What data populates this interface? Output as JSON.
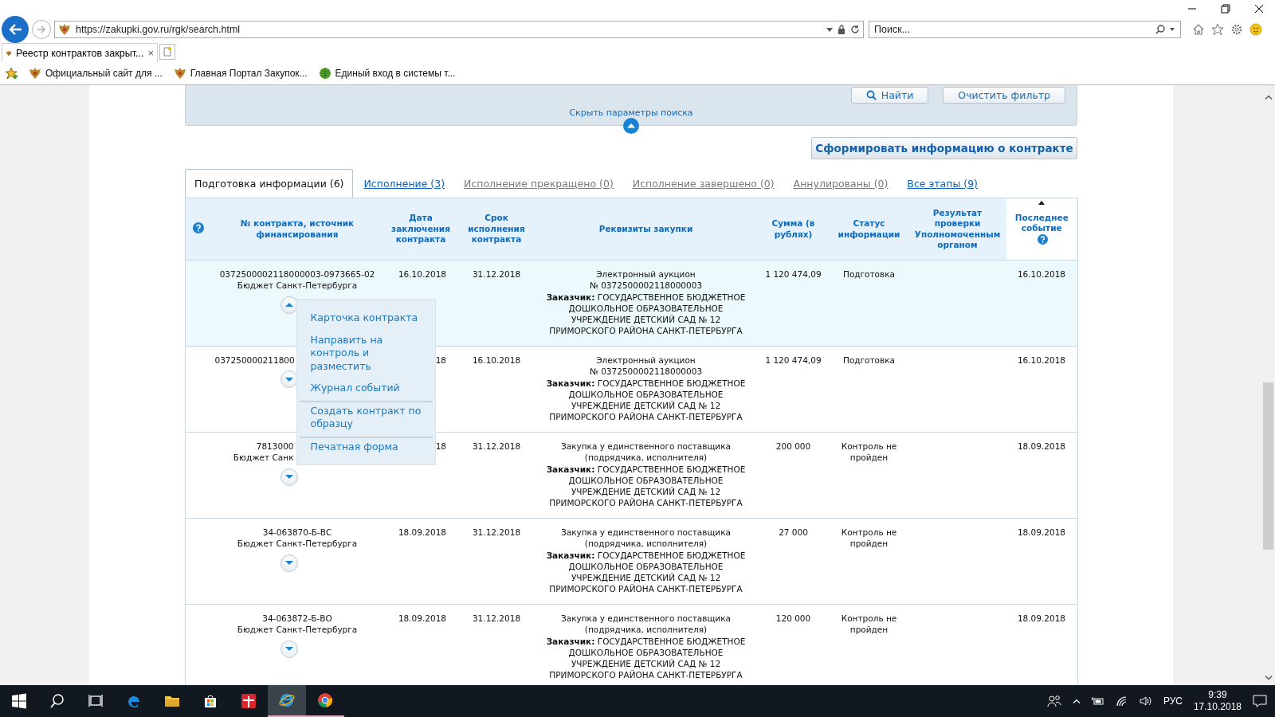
{
  "browser": {
    "address": "https://zakupki.gov.ru/rgk/search.html",
    "search_placeholder": "Поиск...",
    "tabs": [
      {
        "label": "Реестр контрактов закрыт...",
        "selected": true,
        "close": "×"
      }
    ],
    "favorites": [
      {
        "label": "Официальный сайт для ...",
        "kind": "emblem"
      },
      {
        "label": "Главная Портал Закупок...",
        "kind": "emblem"
      },
      {
        "label": "Единый вход в системы т...",
        "kind": "globe"
      }
    ]
  },
  "search_panel": {
    "buttons": [
      {
        "label": "Найти",
        "kind": "search"
      },
      {
        "label": "Очистить фильтр",
        "kind": "plain"
      }
    ],
    "hide_link": "Скрыть параметры поиска"
  },
  "form_button": "Сформировать информацию о контракте",
  "tabs": [
    {
      "label": "Подготовка информации (6)",
      "selected": true,
      "disabled": false
    },
    {
      "label": "Исполнение (3)",
      "selected": false,
      "disabled": false
    },
    {
      "label": "Исполнение прекращено (0)",
      "selected": false,
      "disabled": true
    },
    {
      "label": "Исполнение завершено (0)",
      "selected": false,
      "disabled": true
    },
    {
      "label": "Аннулированы (0)",
      "selected": false,
      "disabled": true
    },
    {
      "label": "Все этапы (9)",
      "selected": false,
      "disabled": false
    }
  ],
  "table": {
    "columns": [
      {
        "label": "№ контракта, источник финансирования"
      },
      {
        "label": "Дата заключения контракта"
      },
      {
        "label": "Срок исполнения контракта"
      },
      {
        "label": "Реквизиты закупки"
      },
      {
        "label": "Сумма (в рублях)"
      },
      {
        "label": "Статус информации"
      },
      {
        "label": "Результат проверки Уполномоченным органом"
      },
      {
        "label": "Последнее событие",
        "sorted": true,
        "help": true
      }
    ],
    "rows": [
      {
        "number": "0372500002118000003-0973665-02",
        "source": "Бюджет Санкт-Петербурга",
        "signed": "16.10.2018",
        "term": "31.12.2018",
        "procurement": "Электронный аукцион № 0372500002118000003",
        "customer": "**Заказчик:** ГОСУДАРСТВЕННОЕ БЮДЖЕТНОЕ ДОШКОЛЬНОЕ ОБРАЗОВАТЕЛЬНОЕ УЧРЕЖДЕНИЕ ДЕТСКИЙ САД № 12 ПРИМОРСКОГО РАЙОНА САНКТ-ПЕТЕРБУРГА",
        "sum": "1 120 474,09",
        "status": "Подготовка",
        "last_event": "16.10.2018",
        "expanded": true,
        "selected": true
      },
      {
        "number": "037250000211800",
        "signed": "18",
        "term": "16.10.2018",
        "procurement": "Электронный аукцион № 0372500002118000003",
        "customer": "**Заказчик:** ГОСУДАРСТВЕННОЕ БЮДЖЕТНОЕ ДОШКОЛЬНОЕ ОБРАЗОВАТЕЛЬНОЕ УЧРЕЖДЕНИЕ ДЕТСКИЙ САД № 12 ПРИМОРСКОГО РАЙОНА САНКТ-ПЕТЕРБУРГА",
        "sum": "1 120 474,09",
        "status": "Подготовка",
        "last_event": "16.10.2018",
        "expanded": false,
        "selected": false
      },
      {
        "number": "7813000",
        "source": "Бюджет Санк",
        "signed": "18",
        "term": "31.12.2018",
        "procurement": "Закупка у единственного поставщика (подрядчика, исполнителя)",
        "customer": "**Заказчик:** ГОСУДАРСТВЕННОЕ БЮДЖЕТНОЕ ДОШКОЛЬНОЕ ОБРАЗОВАТЕЛЬНОЕ УЧРЕЖДЕНИЕ ДЕТСКИЙ САД № 12 ПРИМОРСКОГО РАЙОНА САНКТ-ПЕТЕРБУРГА",
        "sum": "200 000",
        "status": "Контроль не пройден",
        "last_event": "18.09.2018",
        "expanded": false,
        "selected": false
      },
      {
        "number": "34-063870-Б-ВС",
        "source": "Бюджет Санкт-Петербурга",
        "signed": "18.09.2018",
        "term": "31.12.2018",
        "procurement": "Закупка у единственного поставщика (подрядчика, исполнителя)",
        "customer": "**Заказчик:** ГОСУДАРСТВЕННОЕ БЮДЖЕТНОЕ ДОШКОЛЬНОЕ ОБРАЗОВАТЕЛЬНОЕ УЧРЕЖДЕНИЕ ДЕТСКИЙ САД № 12 ПРИМОРСКОГО РАЙОНА САНКТ-ПЕТЕРБУРГА",
        "sum": "27 000",
        "status": "Контроль не пройден",
        "last_event": "18.09.2018",
        "expanded": false,
        "selected": false
      },
      {
        "number": "34-063872-Б-ВО",
        "source": "Бюджет Санкт-Петербурга",
        "signed": "18.09.2018",
        "term": "31.12.2018",
        "procurement": "Закупка у единственного поставщика (подрядчика, исполнителя)",
        "customer": "**Заказчик:** ГОСУДАРСТВЕННОЕ БЮДЖЕТНОЕ ДОШКОЛЬНОЕ ОБРАЗОВАТЕЛЬНОЕ УЧРЕЖДЕНИЕ ДЕТСКИЙ САД № 12 ПРИМОРСКОГО РАЙОНА САНКТ-ПЕТЕРБУРГА",
        "sum": "120 000",
        "status": "Контроль не пройден",
        "last_event": "18.09.2018",
        "expanded": false,
        "selected": false
      }
    ],
    "row_menu": [
      {
        "label": "Карточка контракта",
        "divider_before": false
      },
      {
        "label": "Направить на контроль и разместить",
        "divider_before": false
      },
      {
        "label": "Журнал событий",
        "divider_before": false
      },
      {
        "label": "Создать контракт по образцу",
        "divider_before": true
      },
      {
        "label": "Печатная форма",
        "divider_before": true
      }
    ]
  },
  "taskbar": {
    "apps": [
      {
        "kind": "edge",
        "open": false,
        "active": false
      },
      {
        "kind": "explorer",
        "open": false,
        "active": false
      },
      {
        "kind": "store",
        "open": false,
        "active": false
      },
      {
        "kind": "gift",
        "open": false,
        "active": false
      },
      {
        "kind": "ie",
        "open": true,
        "active": true
      },
      {
        "kind": "chrome",
        "open": true,
        "active": false
      }
    ],
    "language": "РУС",
    "time": "9:39",
    "date": "17.10.2018"
  }
}
